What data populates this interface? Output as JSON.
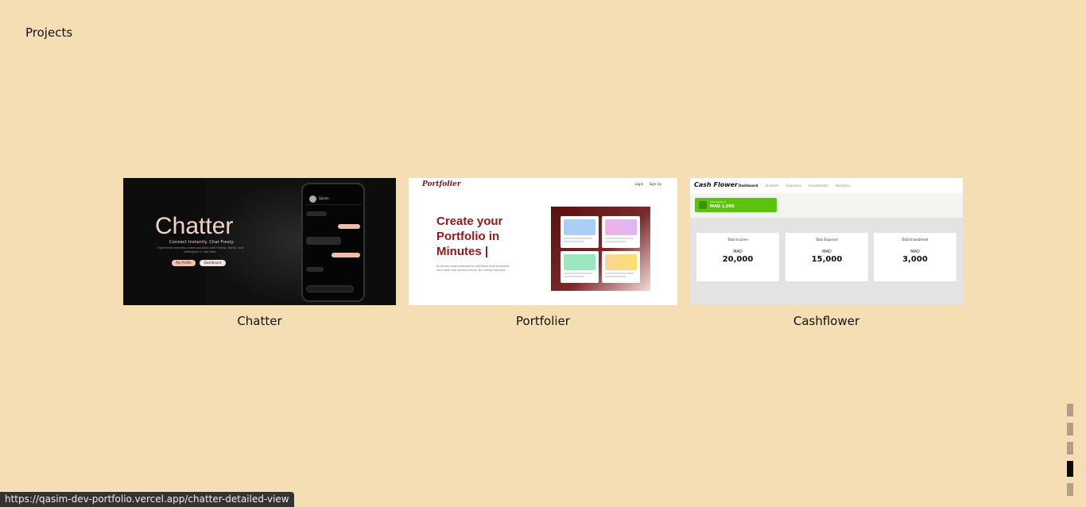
{
  "section": {
    "title": "Projects"
  },
  "projects": [
    {
      "caption": "Chatter",
      "thumb": {
        "title": "Chatter",
        "subtitle": "Connect Instantly. Chat Freely.",
        "description": "Experience seamless communication with friends, family, and colleagues in real-time.",
        "btn_profile": "My Profile",
        "btn_dashboard": "Dashboard",
        "contact": "Qasim",
        "input_placeholder": "Type your message"
      }
    },
    {
      "caption": "Portfolier",
      "thumb": {
        "logo": "Portfolier",
        "nav_login": "Login",
        "nav_signup": "Sign Up",
        "headline": "Create your Portfolio in Minutes |",
        "description": "Build stunning professional portfolios that showcase your work and attract clients. No coding required."
      }
    },
    {
      "caption": "Cashflower",
      "thumb": {
        "logo": "Cash Flower",
        "nav": [
          "Dashboard",
          "Incomes",
          "Expenses",
          "Investments",
          "Analytics"
        ],
        "balance_label": "Total Balance",
        "balance_value": "MAD 2,000",
        "cards": [
          {
            "label": "Total Income",
            "currency": "MAD",
            "amount": "20,000"
          },
          {
            "label": "Total Expense",
            "currency": "MAD",
            "amount": "15,000"
          },
          {
            "label": "Total Investment",
            "currency": "MAD",
            "amount": "3,000"
          }
        ]
      }
    }
  ],
  "pager": {
    "count": 5,
    "active_index": 3
  },
  "status_url": "https://qasim-dev-portfolio.vercel.app/chatter-detailed-view"
}
